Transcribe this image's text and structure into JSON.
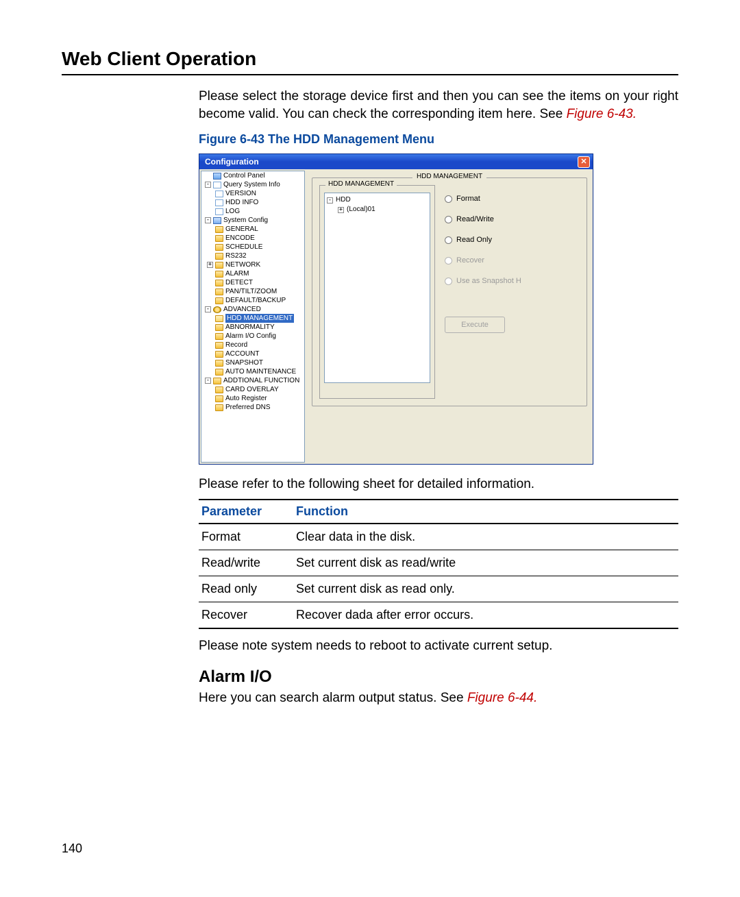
{
  "page_title": "Web Client Operation",
  "intro": "Please select the storage device first and then you can see the items on your right become valid. You can check the corresponding item here. See ",
  "intro_figref": "Figure 6-43.",
  "figure_caption": "Figure 6-43 The HDD Management Menu",
  "window": {
    "title": "Configuration",
    "close_glyph": "✕",
    "nav": {
      "control_panel": "Control Panel",
      "query_system_info": "Query System Info",
      "version": "VERSION",
      "hdd_info": "HDD INFO",
      "log": "LOG",
      "system_config": "System Config",
      "general": "GENERAL",
      "encode": "ENCODE",
      "schedule": "SCHEDULE",
      "rs232": "RS232",
      "network": "NETWORK",
      "alarm": "ALARM",
      "detect": "DETECT",
      "ptz": "PAN/TILT/ZOOM",
      "default_backup": "DEFAULT/BACKUP",
      "advanced": "ADVANCED",
      "hdd_management": "HDD MANAGEMENT",
      "abnormality": "ABNORMALITY",
      "alarm_io_config": "Alarm I/O Config",
      "record": "Record",
      "account": "ACCOUNT",
      "snapshot": "SNAPSHOT",
      "auto_maintenance": "AUTO MAINTENANCE",
      "additional_function": "ADDTIONAL FUNCTION",
      "card_overlay": "CARD OVERLAY",
      "auto_register": "Auto Register",
      "preferred_dns": "Preferred DNS"
    },
    "panel": {
      "outer_legend": "HDD MANAGEMENT",
      "inner_legend": "HDD MANAGEMENT",
      "hdd_root": "HDD",
      "hdd_item": "(Local)01",
      "options": {
        "format": "Format",
        "read_write": "Read/Write",
        "read_only": "Read Only",
        "recover": "Recover",
        "snapshot": "Use as Snapshot H"
      },
      "execute": "Execute"
    }
  },
  "after_figure": "Please refer to the following sheet for detailed information.",
  "table": {
    "headers": {
      "param": "Parameter",
      "func": "Function"
    },
    "rows": [
      {
        "param": "Format",
        "func": "Clear data in the disk."
      },
      {
        "param": "Read/write",
        "func": "Set current disk as read/write"
      },
      {
        "param": "Read only",
        "func": "Set current disk as read only."
      },
      {
        "param": "Recover",
        "func": "Recover dada after error occurs."
      }
    ]
  },
  "note": "Please note system needs to reboot to activate current setup.",
  "section_heading": "Alarm I/O",
  "alarm_text": "Here you can search alarm output status. See ",
  "alarm_figref": "Figure 6-44.",
  "page_number": "140"
}
